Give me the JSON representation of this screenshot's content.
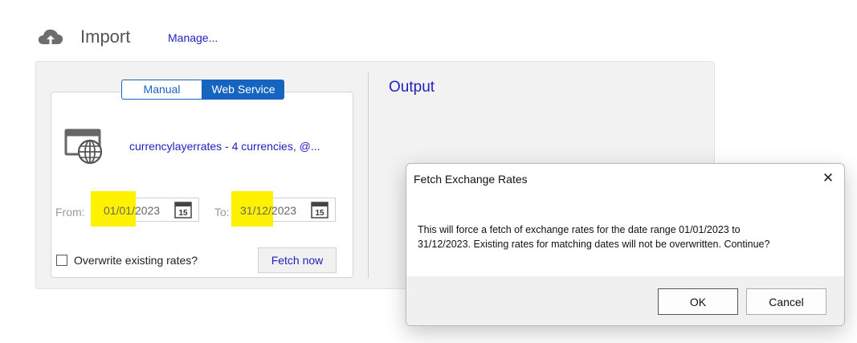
{
  "header": {
    "icon": "cloud-upload-icon",
    "title": "Import",
    "manage_link": "Manage..."
  },
  "tabs": [
    {
      "label": "Manual",
      "active": false
    },
    {
      "label": "Web Service",
      "active": true
    }
  ],
  "service": {
    "icon": "web-service-globe-icon",
    "link": "currencylayerrates - 4 currencies, @..."
  },
  "dates": {
    "from_label": "From:",
    "from_value_part1": "01/01",
    "from_value_part2": "/2023",
    "to_label": "To:",
    "to_value_part1": "31/12",
    "to_value_part2": "/2023",
    "calendar_icon": "calendar-icon",
    "calendar_day": "15",
    "highlight_color": "#fff200"
  },
  "overwrite_label": "Overwrite existing rates?",
  "overwrite_checked": false,
  "fetch_button": "Fetch now",
  "output_title": "Output",
  "dialog": {
    "title": "Fetch Exchange Rates",
    "message_line1": "This will force a fetch of exchange rates for the date range 01/01/2023 to",
    "message_line2": "31/12/2023. Existing rates for matching dates will not be overwritten. Continue?",
    "ok_label": "OK",
    "cancel_label": "Cancel",
    "close_icon": "close-icon"
  },
  "colors": {
    "accent": "#1565c0",
    "link": "#1f1fbf"
  }
}
